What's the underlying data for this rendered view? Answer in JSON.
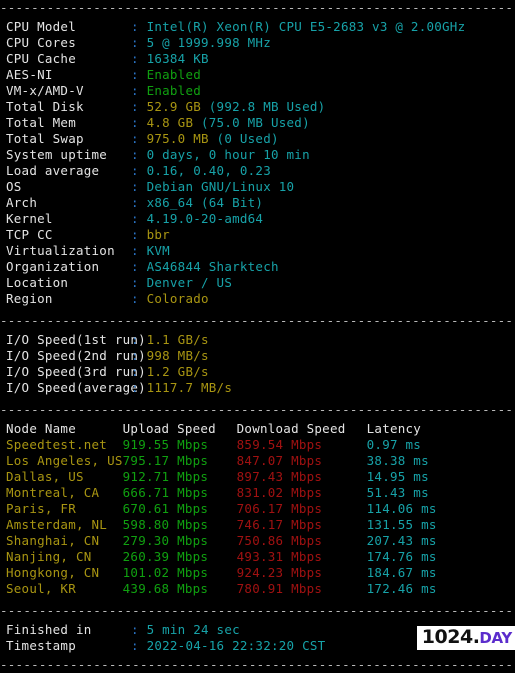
{
  "terminal": {
    "separator": "----------------------------------------------------------------------",
    "sysinfo": [
      {
        "label": "CPU Model",
        "value": "Intel(R) Xeon(R) CPU E5-2683 v3 @ 2.00GHz",
        "color": "cyan"
      },
      {
        "label": "CPU Cores",
        "value": "5 @ 1999.998 MHz",
        "color": "cyan"
      },
      {
        "label": "CPU Cache",
        "value": "16384 KB",
        "color": "cyan"
      },
      {
        "label": "AES-NI",
        "value": "Enabled",
        "color": "green"
      },
      {
        "label": "VM-x/AMD-V",
        "value": "Enabled",
        "color": "green"
      },
      {
        "label": "Total Disk",
        "value": "52.9 GB",
        "value2": " (992.8 MB Used)",
        "color": "yellow",
        "color2": "cyan"
      },
      {
        "label": "Total Mem",
        "value": "4.8 GB",
        "value2": " (75.0 MB Used)",
        "color": "yellow",
        "color2": "cyan"
      },
      {
        "label": "Total Swap",
        "value": "975.0 MB",
        "value2": " (0 Used)",
        "color": "yellow",
        "color2": "cyan"
      },
      {
        "label": "System uptime",
        "value": "0 days, 0 hour 10 min",
        "color": "cyan"
      },
      {
        "label": "Load average",
        "value": "0.16, 0.40, 0.23",
        "color": "cyan"
      },
      {
        "label": "OS",
        "value": "Debian GNU/Linux 10",
        "color": "cyan"
      },
      {
        "label": "Arch",
        "value": "x86_64 (64 Bit)",
        "color": "cyan"
      },
      {
        "label": "Kernel",
        "value": "4.19.0-20-amd64",
        "color": "cyan"
      },
      {
        "label": "TCP CC",
        "value": "bbr",
        "color": "yellow"
      },
      {
        "label": "Virtualization",
        "value": "KVM",
        "color": "cyan"
      },
      {
        "label": "Organization",
        "value": "AS46844 Sharktech",
        "color": "cyan"
      },
      {
        "label": "Location",
        "value": "Denver / US",
        "color": "cyan"
      },
      {
        "label": "Region",
        "value": "Colorado",
        "color": "yellow"
      }
    ],
    "iospeed": [
      {
        "label": "I/O Speed(1st run)",
        "value": "1.1 GB/s"
      },
      {
        "label": "I/O Speed(2nd run)",
        "value": "998 MB/s"
      },
      {
        "label": "I/O Speed(3rd run)",
        "value": "1.2 GB/s"
      },
      {
        "label": "I/O Speed(average)",
        "value": "1117.7 MB/s"
      }
    ],
    "speedtest": {
      "headers": [
        "Node Name",
        "Upload Speed",
        "Download Speed",
        "Latency"
      ],
      "rows": [
        {
          "node": "Speedtest.net",
          "upload": "919.55 Mbps",
          "download": "859.54 Mbps",
          "latency": "0.97 ms"
        },
        {
          "node": "Los Angeles, US",
          "upload": "795.17 Mbps",
          "download": "847.07 Mbps",
          "latency": "38.38 ms"
        },
        {
          "node": "Dallas, US",
          "upload": "912.71 Mbps",
          "download": "897.43 Mbps",
          "latency": "14.95 ms"
        },
        {
          "node": "Montreal, CA",
          "upload": "666.71 Mbps",
          "download": "831.02 Mbps",
          "latency": "51.43 ms"
        },
        {
          "node": "Paris, FR",
          "upload": "670.61 Mbps",
          "download": "706.17 Mbps",
          "latency": "114.06 ms"
        },
        {
          "node": "Amsterdam, NL",
          "upload": "598.80 Mbps",
          "download": "746.17 Mbps",
          "latency": "131.55 ms"
        },
        {
          "node": "Shanghai, CN",
          "upload": "279.30 Mbps",
          "download": "750.86 Mbps",
          "latency": "207.43 ms"
        },
        {
          "node": "Nanjing, CN",
          "upload": "260.39 Mbps",
          "download": "493.31 Mbps",
          "latency": "174.76 ms"
        },
        {
          "node": "Hongkong, CN",
          "upload": "101.02 Mbps",
          "download": "924.23 Mbps",
          "latency": "184.67 ms"
        },
        {
          "node": "Seoul, KR",
          "upload": "439.68 Mbps",
          "download": "780.91 Mbps",
          "latency": "172.46 ms"
        }
      ]
    },
    "footer": [
      {
        "label": "Finished in",
        "value": "5 min 24 sec"
      },
      {
        "label": "Timestamp",
        "value": "2022-04-16 22:32:20 CST"
      }
    ]
  },
  "watermark": {
    "number": "1024",
    "dot": ".",
    "suffix": "DAY",
    "number_color": "#111111",
    "suffix_color": "#5b2ccc"
  }
}
